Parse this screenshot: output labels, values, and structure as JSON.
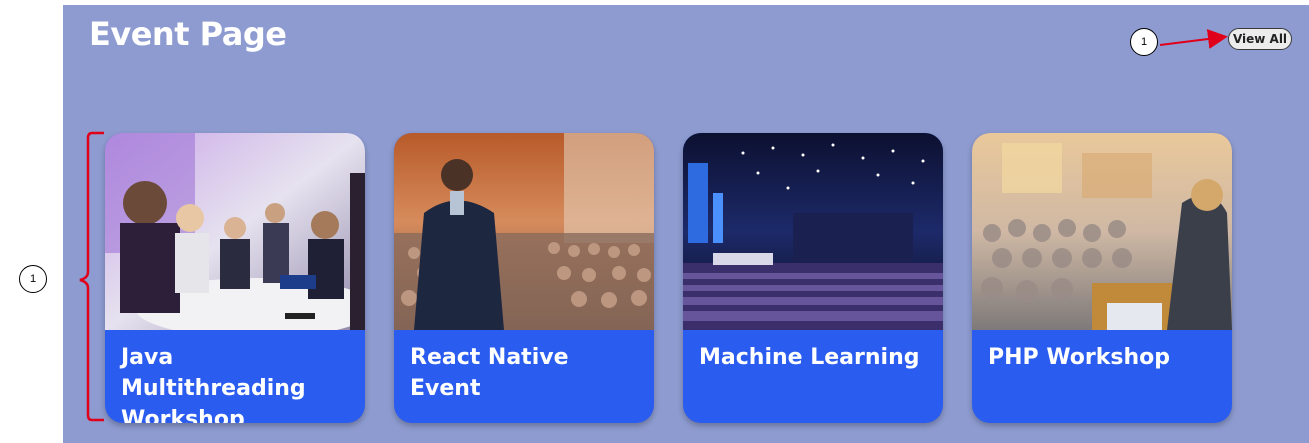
{
  "page": {
    "title": "Event Page",
    "view_all_label": "View All"
  },
  "annotations": {
    "callout_top": "1",
    "callout_left": "1"
  },
  "events": [
    {
      "title": "Java Multithreading Workshop"
    },
    {
      "title": "React Native Event"
    },
    {
      "title": "Machine Learning"
    },
    {
      "title": "PHP Workshop"
    }
  ],
  "colors": {
    "panel_bg": "#8d9bd0",
    "card_bg": "#2b5cf0",
    "annotation": "#e0001b"
  }
}
